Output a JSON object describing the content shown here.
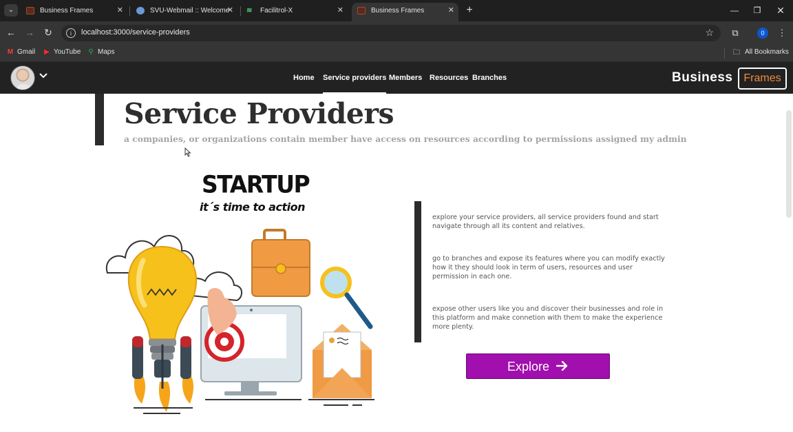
{
  "browser": {
    "tabs": [
      {
        "title": "Business Frames",
        "favicon": "business-frames-favicon",
        "active": false
      },
      {
        "title": "SVU-Webmail :: Welcome",
        "favicon": "globe-favicon",
        "active": false
      },
      {
        "title": "Facilitrol-X",
        "favicon": "facilitrol-favicon",
        "active": false
      },
      {
        "title": "Business Frames",
        "favicon": "business-frames-favicon",
        "active": true
      }
    ],
    "url": "localhost:3000/service-providers",
    "profile_initial": "0",
    "bookmarks": [
      {
        "label": "Gmail",
        "icon": "gmail-icon"
      },
      {
        "label": "YouTube",
        "icon": "youtube-icon"
      },
      {
        "label": "Maps",
        "icon": "maps-icon"
      }
    ],
    "all_bookmarks_label": "All Bookmarks"
  },
  "navbar": {
    "links": [
      {
        "label": "Home",
        "active": false
      },
      {
        "label": "Service providers",
        "active": true
      },
      {
        "label": "Members",
        "active": false
      },
      {
        "label": "Resources",
        "active": false
      },
      {
        "label": "Branches",
        "active": false
      }
    ],
    "brand_word": "Business",
    "brand_boxed": "Frames",
    "brand_accent_color": "#ef8a3c"
  },
  "page": {
    "title": "Service Providers",
    "subtitle": "a companies, or organizations contain member have access on resources according to permissions assigned my admin",
    "illustration": {
      "headline": "STARTUP",
      "tagline": "it´s time to action"
    },
    "descriptions": [
      "explore your service providers, all service providers found and start navigate through all its content and relatives.",
      "go to branches and expose its features where you can modify exactly how it they should look in term of users, resources and user permission in each one.",
      "expose other users like you and discover their businesses and role in this platform and make connetion with them to make the experience more plenty."
    ],
    "explore_label": "Explore",
    "explore_color": "#a10fae"
  }
}
